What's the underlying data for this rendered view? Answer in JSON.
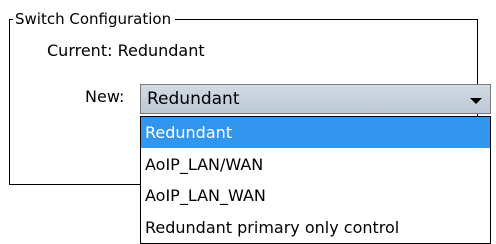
{
  "switch_config": {
    "legend": "Switch Configuration",
    "current_text": "Current: Redundant",
    "new_label": "New:",
    "selected_value": "Redundant",
    "dropdown_icon": "chevron-down-icon",
    "highlight_color": "#3296ef",
    "options": [
      "Redundant",
      "AoIP_LAN/WAN",
      "AoIP_LAN_WAN",
      "Redundant primary only control"
    ]
  }
}
